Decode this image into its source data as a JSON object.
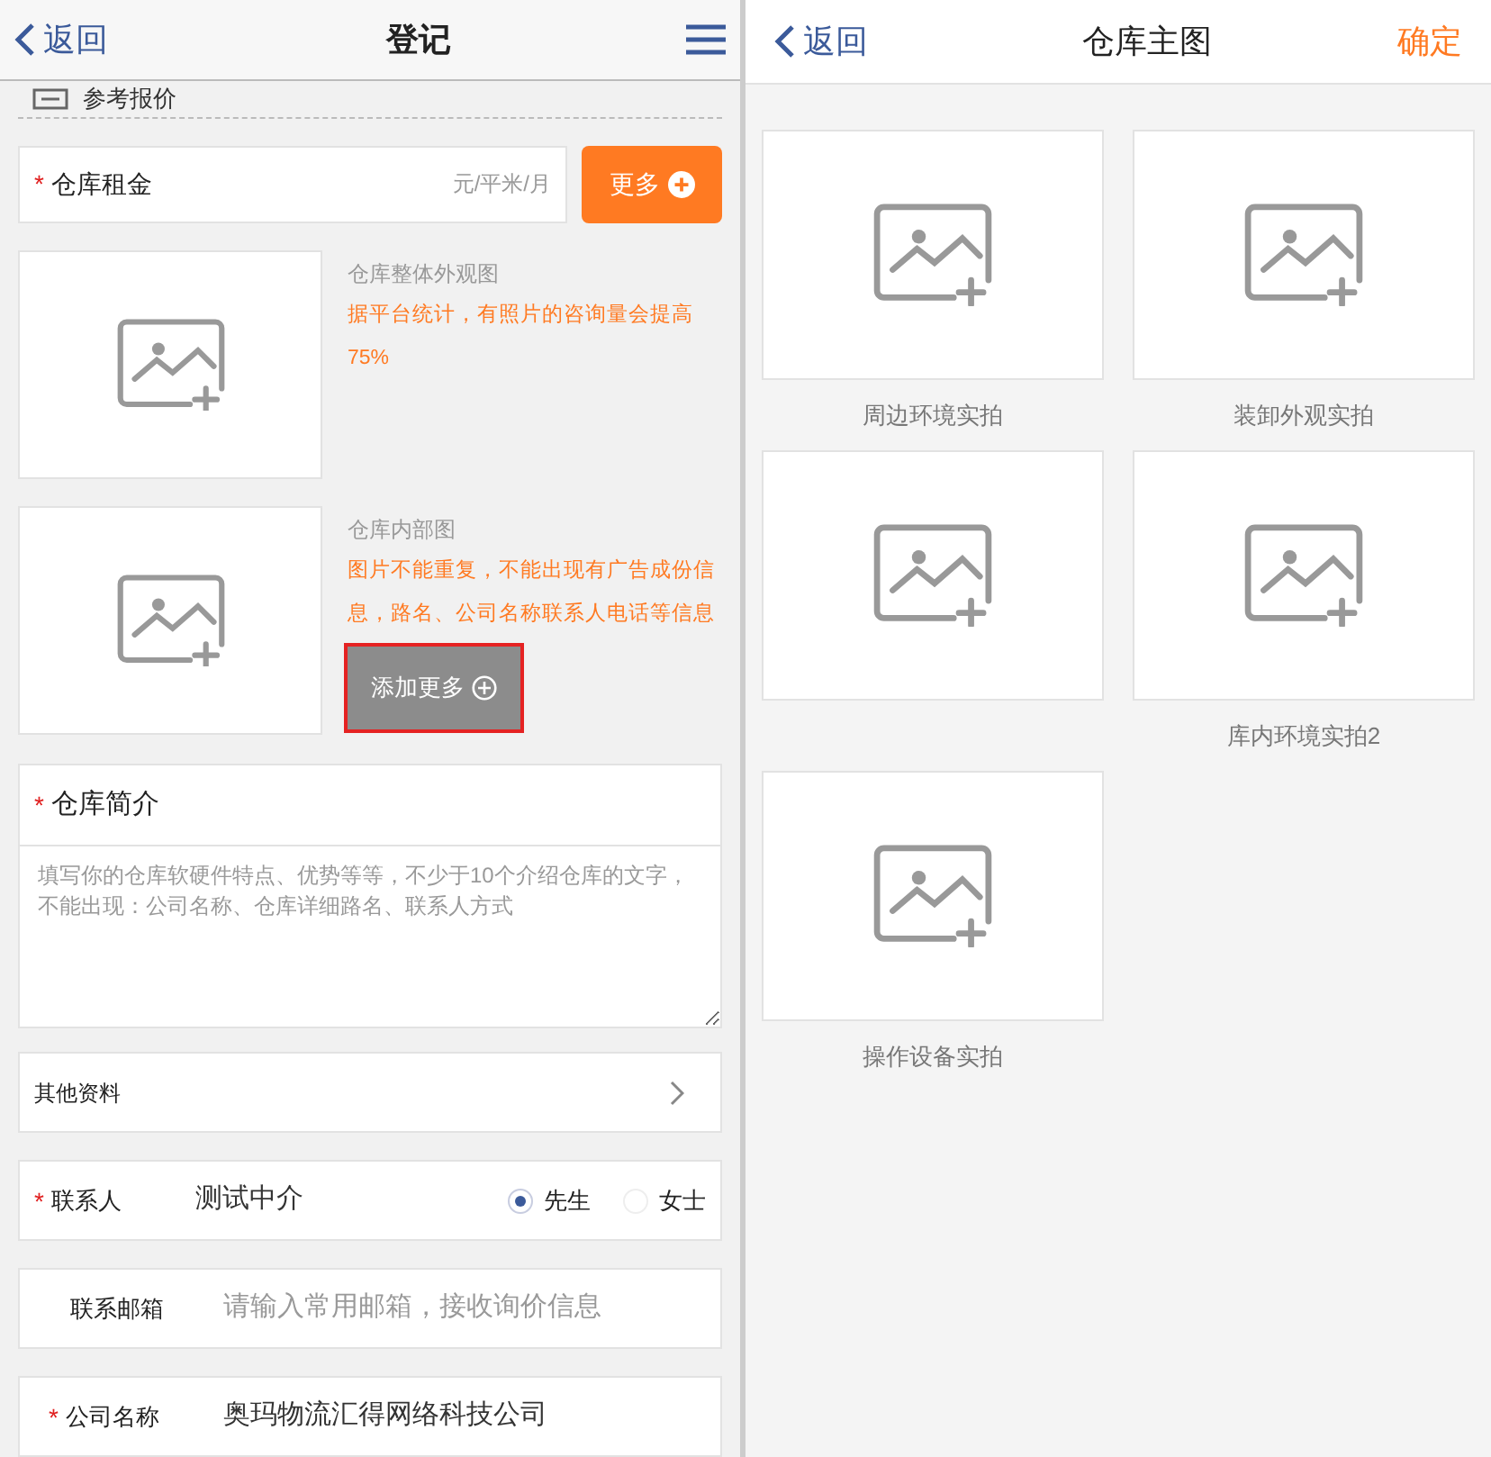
{
  "left": {
    "header": {
      "back": "返回",
      "title": "登记"
    },
    "section_title": "参考报价",
    "rent": {
      "label": "仓库租金",
      "required_mark": "*",
      "unit": "元/平米/月",
      "more_button": "更多"
    },
    "photo_slots": [
      {
        "title": "仓库整体外观图",
        "hint": "据平台统计，有照片的咨询量会提高75%"
      },
      {
        "title": "仓库内部图",
        "hint": "图片不能重复，不能出现有广告成份信息，路名、公司名称联系人电话等信息"
      }
    ],
    "add_more_button": "添加更多",
    "intro": {
      "label": "仓库简介",
      "required_mark": "*",
      "placeholder": "填写你的仓库软硬件特点、优势等等，不少于10个介绍仓库的文字，不能出现：公司名称、仓库详细路名、联系人方式"
    },
    "other": {
      "label": "其他资料"
    },
    "contact": {
      "label": "联系人",
      "required_mark": "*",
      "value": "测试中介",
      "options": [
        {
          "label": "先生",
          "selected": true
        },
        {
          "label": "女士",
          "selected": false
        }
      ]
    },
    "email": {
      "label": "联系邮箱",
      "placeholder": "请输入常用邮箱，接收询价信息"
    },
    "company": {
      "label": "公司名称",
      "required_mark": "*",
      "value": "奥玛物流汇得网络科技公司"
    }
  },
  "right": {
    "header": {
      "back": "返回",
      "title": "仓库主图",
      "confirm": "确定"
    },
    "tiles": [
      {
        "kind": "photo_slot",
        "label": "周边环境实拍"
      },
      {
        "kind": "photo_slot",
        "label": "装卸外观实拍"
      },
      {
        "kind": "photo_slot"
      },
      {
        "kind": "photo_slot",
        "label": "库内环境实拍2"
      },
      {
        "kind": "photo_slot",
        "label": "操作设备实拍"
      }
    ]
  }
}
